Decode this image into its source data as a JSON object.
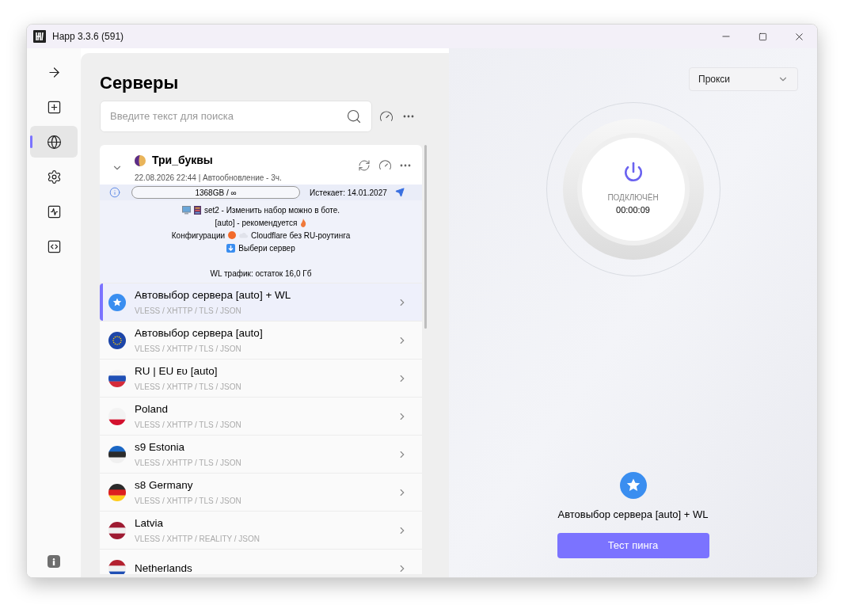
{
  "window": {
    "title": "Happ 3.3.6 (591)"
  },
  "sidebar": {
    "items": [
      {
        "kind": "arrow",
        "selected": false
      },
      {
        "kind": "add",
        "selected": false
      },
      {
        "kind": "globe",
        "selected": true
      },
      {
        "kind": "settings",
        "selected": false
      },
      {
        "kind": "activity",
        "selected": false
      },
      {
        "kind": "code",
        "selected": false
      }
    ]
  },
  "servers_panel": {
    "title": "Серверы",
    "search": {
      "placeholder": "Введите текст для поиска"
    },
    "subscription": {
      "expanded": true,
      "name": "Три_буквы",
      "updated": "22.08.2026 22:44 | Автообновление - 3ч.",
      "traffic": "1368GB / ∞",
      "expires": "Истекает: 14.01.2027",
      "lines": [
        {
          "kind": "set",
          "text": "set2 - Изменить набор можно в боте."
        },
        {
          "kind": "recommend",
          "text": "[auto] - рекомендуется"
        },
        {
          "kind": "config",
          "text": "Конфигурации",
          "text_2": "Cloudflare без RU-роутинга"
        },
        {
          "kind": "choose",
          "text": "Выбери сервер"
        },
        {
          "kind": "gap"
        },
        {
          "kind": "plain",
          "text": "WL трафик: остаток 16,0 Гб"
        }
      ]
    },
    "servers": [
      {
        "kind": "star",
        "name": "Автовыбор сервера [auto] + WL",
        "protocol": "VLESS / XHTTP / TLS / JSON",
        "selected": true
      },
      {
        "kind": "eu",
        "name": "Автовыбор сервера [auto]",
        "protocol": "VLESS / XHTTP / TLS / JSON",
        "selected": false
      },
      {
        "kind": "ru",
        "name": "RU | EU ᴇᴜ [auto]",
        "protocol": "VLESS / XHTTP / TLS / JSON",
        "selected": false
      },
      {
        "kind": "pl",
        "name": "Poland",
        "protocol": "VLESS / XHTTP / TLS / JSON",
        "selected": false
      },
      {
        "kind": "ee",
        "name": "s9 Estonia",
        "protocol": "VLESS / XHTTP / TLS / JSON",
        "selected": false
      },
      {
        "kind": "de",
        "name": "s8 Germany",
        "protocol": "VLESS / XHTTP / TLS / JSON",
        "selected": false
      },
      {
        "kind": "lv",
        "name": "Latvia",
        "protocol": "VLESS / XHTTP / REALITY / JSON",
        "selected": false
      },
      {
        "kind": "nl",
        "name": "Netherlands",
        "selected": false
      }
    ]
  },
  "connection": {
    "mode": "Прокси",
    "status": "ПОДКЛЮЧЁН",
    "time": "00:00:09",
    "current_server": {
      "kind": "star",
      "name": "Автовыбор сервера [auto] + WL"
    },
    "ping_button": "Тест пинга"
  }
}
